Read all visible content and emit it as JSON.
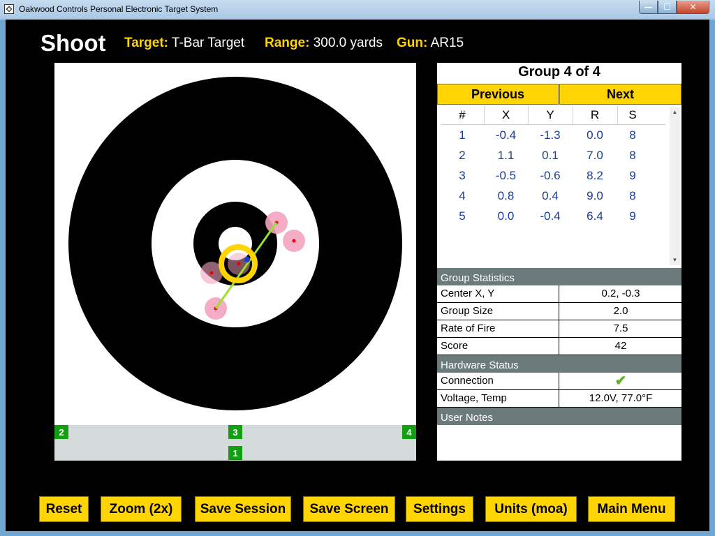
{
  "window": {
    "title": "Oakwood Controls Personal Electronic Target System",
    "min": "—",
    "max": "☐",
    "close": "✕"
  },
  "header": {
    "title": "Shoot",
    "target_label": "Target:",
    "target_value": "T-Bar Target",
    "range_label": "Range:",
    "range_value": "300.0 yards",
    "gun_label": "Gun:",
    "gun_value": "AR15"
  },
  "sensors": [
    "2",
    "3",
    "4",
    "1"
  ],
  "group": {
    "title": "Group 4 of 4",
    "previous": "Previous",
    "next": "Next",
    "columns": [
      "#",
      "X",
      "Y",
      "R",
      "S"
    ],
    "shots": [
      [
        "1",
        "-0.4",
        "-1.3",
        "0.0",
        "8"
      ],
      [
        "2",
        "1.1",
        "0.1",
        "7.0",
        "8"
      ],
      [
        "3",
        "-0.5",
        "-0.6",
        "8.2",
        "9"
      ],
      [
        "4",
        "0.8",
        "0.4",
        "9.0",
        "8"
      ],
      [
        "5",
        "0.0",
        "-0.4",
        "6.4",
        "9"
      ]
    ]
  },
  "group_stats": {
    "header": "Group Statistics",
    "rows": [
      [
        "Center X, Y",
        "0.2, -0.3"
      ],
      [
        "Group Size",
        "2.0"
      ],
      [
        "Rate of Fire",
        "7.5"
      ],
      [
        "Score",
        "42"
      ]
    ]
  },
  "hardware": {
    "header": "Hardware Status",
    "connection_label": "Connection",
    "connection_value": "✔",
    "voltage_label": "Voltage, Temp",
    "voltage_value": "12.0V, 77.0°F"
  },
  "notes": {
    "header": "User Notes"
  },
  "buttons": [
    "Reset",
    "Zoom (2x)",
    "Save Session",
    "Save Screen",
    "Settings",
    "Units (moa)",
    "Main Menu"
  ],
  "colors": {
    "accent": "#ffd400",
    "sensor": "#139e13",
    "table_text": "#1b3d99",
    "section": "#6b7a7a"
  }
}
